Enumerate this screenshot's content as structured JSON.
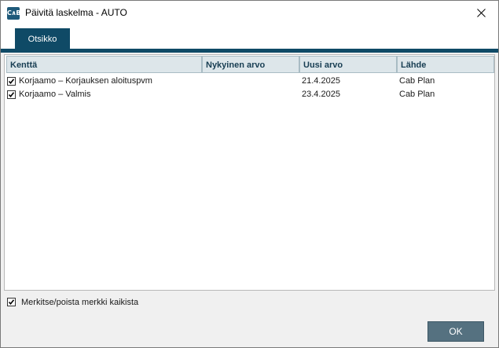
{
  "window": {
    "title": "Päivitä laskelma - AUTO",
    "icon": "cab-plan-app-icon",
    "icon_text": "C∧B",
    "close_icon": "close-icon"
  },
  "tabs": [
    {
      "label": "Otsikko",
      "selected": true
    }
  ],
  "table": {
    "columns": [
      "Kenttä",
      "Nykyinen arvo",
      "Uusi arvo",
      "Lähde"
    ],
    "rows": [
      {
        "checked": true,
        "field": "Korjaamo – Korjauksen aloituspvm",
        "current": "",
        "new": "21.4.2025",
        "source": "Cab Plan"
      },
      {
        "checked": true,
        "field": "Korjaamo – Valmis",
        "current": "",
        "new": "23.4.2025",
        "source": "Cab Plan"
      }
    ]
  },
  "footer": {
    "toggle_all_label": "Merkitse/poista merkki kaikista",
    "toggle_all_checked": true,
    "ok_label": "OK"
  },
  "colors": {
    "accent": "#0f4a66",
    "ok_button": "#557180",
    "header_bg": "#dde6ea"
  }
}
